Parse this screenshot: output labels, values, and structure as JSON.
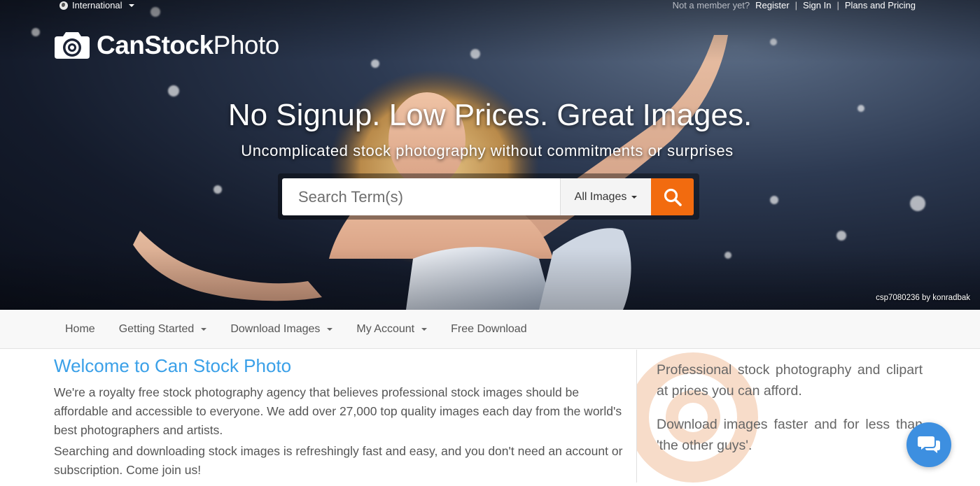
{
  "topbar": {
    "region_label": "International",
    "member_prompt": "Not a member yet?",
    "register": "Register",
    "separator": "|",
    "sign_in": "Sign In",
    "plans": "Plans and Pricing"
  },
  "brand": {
    "name_bold": "CanStock",
    "name_light": "Photo"
  },
  "hero": {
    "headline": "No Signup. Low Prices. Great Images.",
    "subhead": "Uncomplicated stock photography without commitments or surprises",
    "credit": "csp7080236 by konradbak"
  },
  "search": {
    "placeholder": "Search Term(s)",
    "type_selected": "All Images",
    "accent": "#f26b0f"
  },
  "nav": {
    "items": [
      {
        "label": "Home"
      },
      {
        "label": "Getting Started"
      },
      {
        "label": "Download Images"
      },
      {
        "label": "My Account"
      },
      {
        "label": "Free Download"
      }
    ]
  },
  "welcome": {
    "title": "Welcome to Can Stock Photo",
    "p1": "We're a royalty free stock photography agency that believes professional stock images should be affordable and accessible to everyone. We add over 27,000 top quality images each day from the world's best photographers and artists.",
    "p2": "Searching and downloading stock images is refreshingly fast and easy, and you don't need an account or subscription. Come join us!"
  },
  "aside": {
    "p1": "Professional stock photography and clipart at prices you can afford.",
    "p2": "Download images faster and for less than 'the other guys'."
  },
  "colors": {
    "title_blue": "#3aa0e8",
    "chat_blue": "#3d8fe0"
  },
  "icons": {
    "globe": "globe-icon",
    "search": "search-icon",
    "chat": "chat-icon",
    "logo": "camera-logo-icon"
  }
}
